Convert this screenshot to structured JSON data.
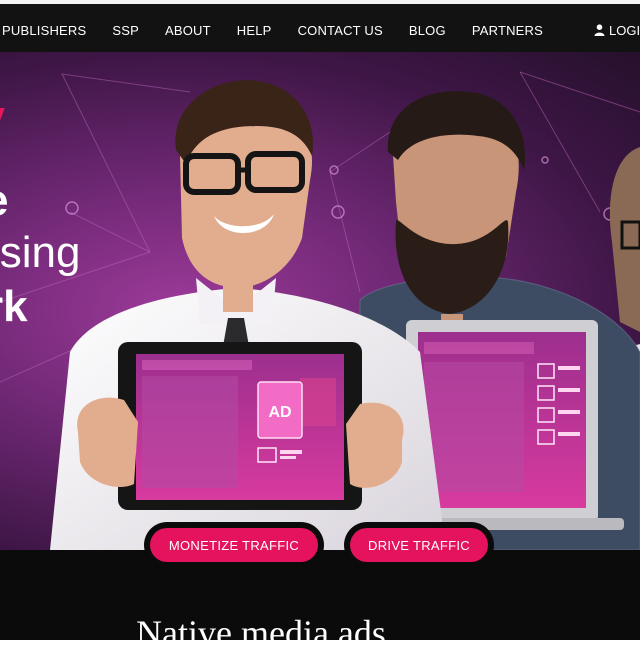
{
  "nav": {
    "items": [
      {
        "label": "PUBLISHERS"
      },
      {
        "label": "SSP"
      },
      {
        "label": "ABOUT"
      },
      {
        "label": "HELP"
      },
      {
        "label": "CONTACT US"
      },
      {
        "label": "BLOG"
      },
      {
        "label": "PARTNERS"
      }
    ],
    "login_label": "LOGI"
  },
  "hero": {
    "accent": "y",
    "line1": "e",
    "line2": "ising",
    "line3": "rk",
    "ad_badge": "AD"
  },
  "cta": {
    "monetize_label": "MONETIZE TRAFFIC",
    "drive_label": "DRIVE TRAFFIC"
  },
  "section": {
    "title": "Native media ads"
  },
  "colors": {
    "accent": "#e5135d",
    "nav_bg": "#121212",
    "hero_purple": "#6f2874"
  },
  "icons": {
    "login": "user-icon"
  }
}
